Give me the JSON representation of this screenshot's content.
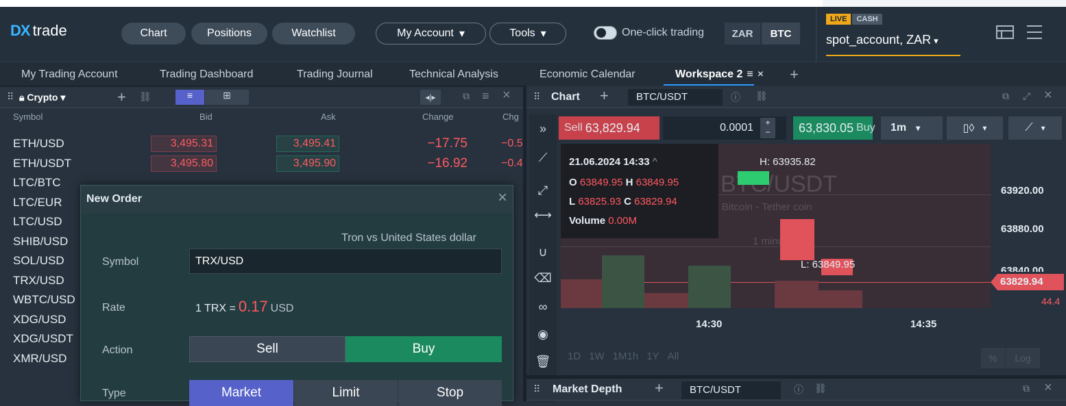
{
  "app": {
    "logo": "trade",
    "logo_mark": "DX"
  },
  "nav": {
    "chart": "Chart",
    "positions": "Positions",
    "watchlist": "Watchlist",
    "my_account": "My Account",
    "tools": "Tools",
    "one_click": "One-click trading",
    "cur_zar": "ZAR",
    "cur_btc": "BTC"
  },
  "account": {
    "live": "LIVE",
    "cash": "CASH",
    "name": "spot_account, ZAR"
  },
  "tabs": [
    "My Trading Account",
    "Trading Dashboard",
    "Trading Journal",
    "Technical Analysis",
    "Economic Calendar",
    "Workspace 2"
  ],
  "watchlist": {
    "title": "Crypto",
    "cols": [
      "Symbol",
      "Bid",
      "Ask",
      "Change",
      "Chg"
    ],
    "rows": [
      {
        "symbol": "ETH/USD",
        "bid": "3,495.31",
        "ask": "3,495.41",
        "change": "−17.75",
        "chg": "−0.5"
      },
      {
        "symbol": "ETH/USDT",
        "bid": "3,495.80",
        "ask": "3,495.90",
        "change": "−16.92",
        "chg": "−0.4"
      },
      {
        "symbol": "LTC/BTC",
        "bid": "",
        "ask": "",
        "change": "",
        "chg": ""
      },
      {
        "symbol": "LTC/EUR",
        "bid": "",
        "ask": "",
        "change": "",
        "chg": ""
      },
      {
        "symbol": "LTC/USD",
        "bid": "",
        "ask": "",
        "change": "",
        "chg": ""
      },
      {
        "symbol": "SHIB/USD",
        "bid": "",
        "ask": "",
        "change": "",
        "chg": ""
      },
      {
        "symbol": "SOL/USD",
        "bid": "",
        "ask": "",
        "change": "",
        "chg": ""
      },
      {
        "symbol": "TRX/USD",
        "bid": "",
        "ask": "",
        "change": "",
        "chg": ""
      },
      {
        "symbol": "WBTC/USD",
        "bid": "",
        "ask": "",
        "change": "",
        "chg": ""
      },
      {
        "symbol": "XDG/USD",
        "bid": "",
        "ask": "",
        "change": "",
        "chg": ""
      },
      {
        "symbol": "XDG/USDT",
        "bid": "",
        "ask": "",
        "change": "",
        "chg": ""
      },
      {
        "symbol": "XMR/USD",
        "bid": "",
        "ask": "",
        "change": "",
        "chg": ""
      }
    ]
  },
  "order": {
    "title": "New Order",
    "subtitle": "Tron vs United States dollar",
    "symbol_label": "Symbol",
    "symbol": "TRX/USD",
    "rate_label": "Rate",
    "rate_prefix": "1 TRX =",
    "rate_value": "0.17",
    "rate_unit": "USD",
    "action_label": "Action",
    "sell": "Sell",
    "buy": "Buy",
    "type_label": "Type",
    "market": "Market",
    "limit": "Limit",
    "stop": "Stop"
  },
  "chart": {
    "title": "Chart",
    "symbol": "BTC/USDT",
    "sell_label": "Sell",
    "sell_price": "63,829.94",
    "qty": "0.0001",
    "buy_price": "63,830.05",
    "buy_label": "Buy",
    "interval": "1m",
    "ohlc_date": "21.06.2024 14:33",
    "o": "63849.95",
    "h": "63849.95",
    "l": "63825.93",
    "c": "63829.94",
    "volume": "0.00M",
    "high_label": "H: 63935.82",
    "low_label": "L: 63849.95",
    "watermark": "BTC/USDT",
    "watermark_sub": "Bitcoin - Tether coin",
    "watermark_int": "1 minute",
    "y_labels": [
      "63920.00",
      "63880.00",
      "63840.00"
    ],
    "last_price": "63829.94",
    "vol_label": "44.4",
    "x_labels": [
      "14:30",
      "14:35"
    ],
    "ranges": [
      "1D",
      "1W",
      "1M",
      "1h",
      "1Y",
      "All"
    ],
    "pct": "%",
    "log": "Log"
  },
  "depth": {
    "title": "Market Depth",
    "symbol": "BTC/USDT"
  },
  "colors": {
    "accent": "#2e9bff",
    "sell": "#c7424a",
    "buy": "#1b8a5f",
    "type_active": "#5661c9"
  }
}
